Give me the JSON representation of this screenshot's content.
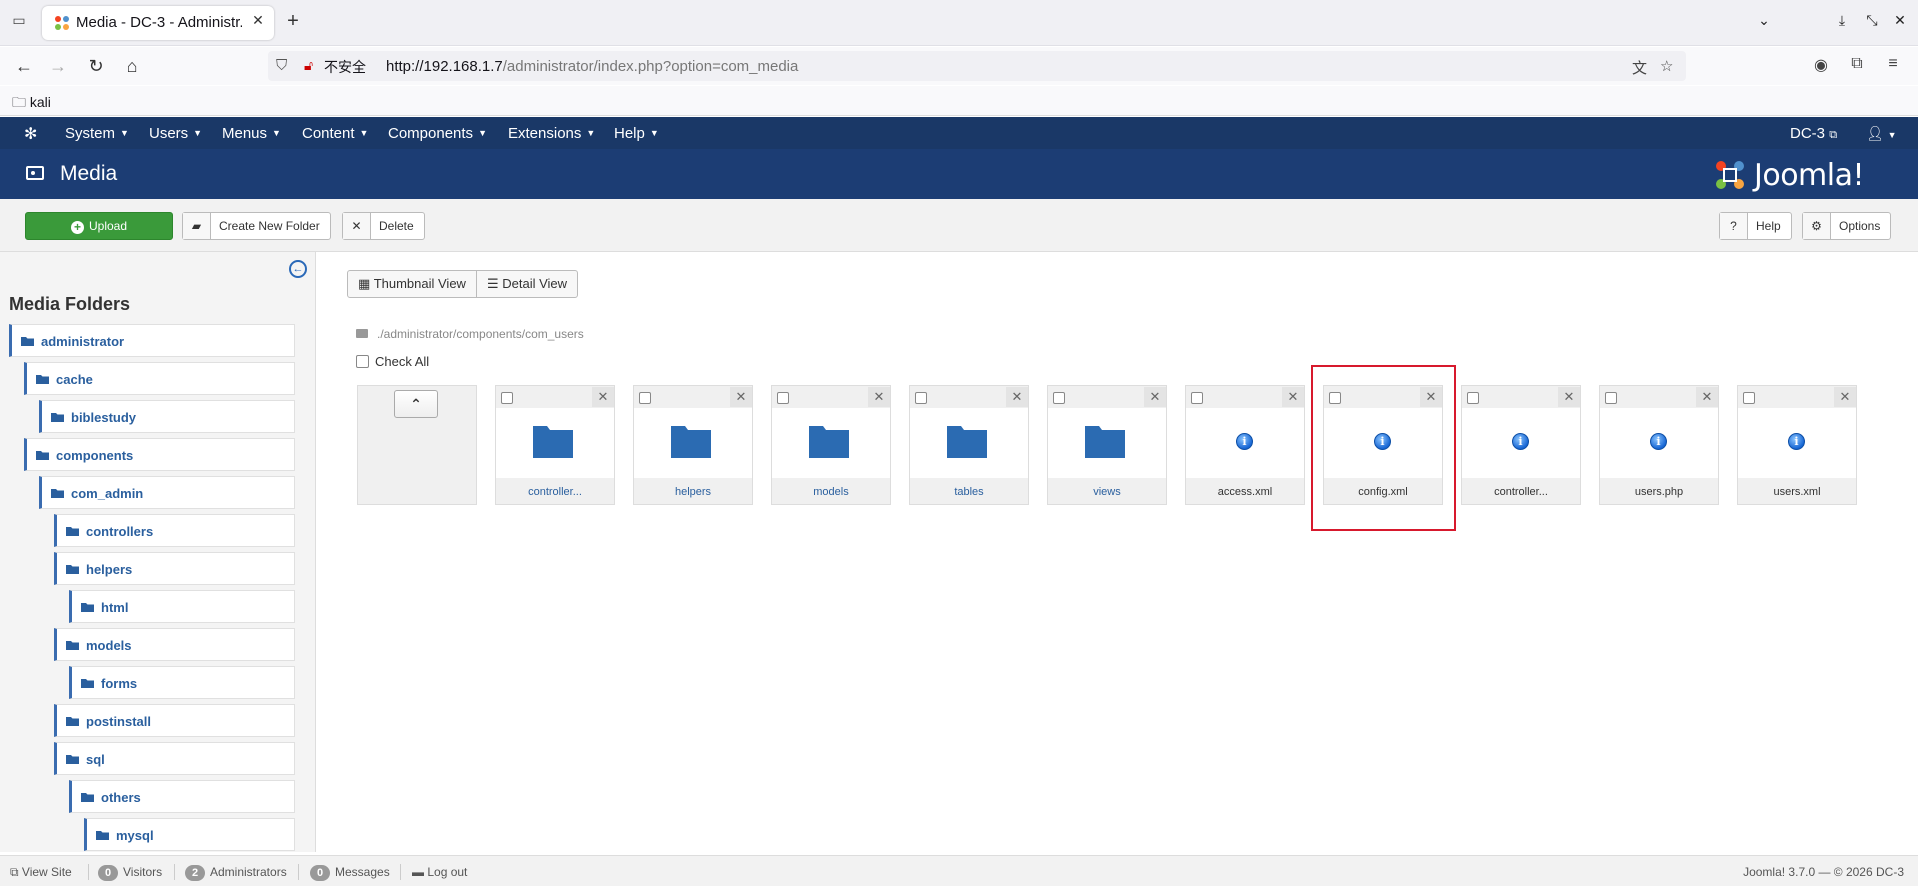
{
  "browser": {
    "tab_title": "Media - DC-3 - Administr...",
    "url_host": "http://192.168.1.7",
    "url_path": "/administrator/index.php?option=com_media",
    "security_label": "不安全",
    "bookmark": "kali"
  },
  "jnav": {
    "menus": [
      "System",
      "Users",
      "Menus",
      "Content",
      "Components",
      "Extensions",
      "Help"
    ],
    "site": "DC-3"
  },
  "header": {
    "title": "Media",
    "brand": "Joomla!"
  },
  "toolbar": {
    "upload": "Upload",
    "new_folder": "Create New Folder",
    "delete": "Delete",
    "help": "Help",
    "options": "Options"
  },
  "sidebar": {
    "title": "Media Folders",
    "folders": [
      {
        "name": "administrator",
        "depth": 0
      },
      {
        "name": "cache",
        "depth": 1
      },
      {
        "name": "biblestudy",
        "depth": 2
      },
      {
        "name": "components",
        "depth": 1
      },
      {
        "name": "com_admin",
        "depth": 2
      },
      {
        "name": "controllers",
        "depth": 3
      },
      {
        "name": "helpers",
        "depth": 3
      },
      {
        "name": "html",
        "depth": 4
      },
      {
        "name": "models",
        "depth": 3
      },
      {
        "name": "forms",
        "depth": 4
      },
      {
        "name": "postinstall",
        "depth": 3
      },
      {
        "name": "sql",
        "depth": 3
      },
      {
        "name": "others",
        "depth": 4
      },
      {
        "name": "mysql",
        "depth": 5
      }
    ]
  },
  "main": {
    "views": [
      "Thumbnail View",
      "Detail View"
    ],
    "path": "./administrator/components/com_users",
    "check_all": "Check All",
    "items": [
      {
        "name": "controller...",
        "kind": "folder"
      },
      {
        "name": "helpers",
        "kind": "folder"
      },
      {
        "name": "models",
        "kind": "folder"
      },
      {
        "name": "tables",
        "kind": "folder"
      },
      {
        "name": "views",
        "kind": "folder"
      },
      {
        "name": "access.xml",
        "kind": "file"
      },
      {
        "name": "config.xml",
        "kind": "file",
        "highlighted": true
      },
      {
        "name": "controller...",
        "kind": "file"
      },
      {
        "name": "users.php",
        "kind": "file"
      },
      {
        "name": "users.xml",
        "kind": "file"
      }
    ]
  },
  "status": {
    "view_site": "View Site",
    "visitors_count": "0",
    "visitors": "Visitors",
    "admins_count": "2",
    "admins": "Administrators",
    "messages_count": "0",
    "messages": "Messages",
    "logout": "Log out",
    "version": "Joomla! 3.7.0  —  © 2026 DC-3"
  },
  "colors": {
    "nav": "#1a3867",
    "title": "#1c3d74",
    "upload": "#3a9a3a",
    "highlight": "#d7192d"
  }
}
